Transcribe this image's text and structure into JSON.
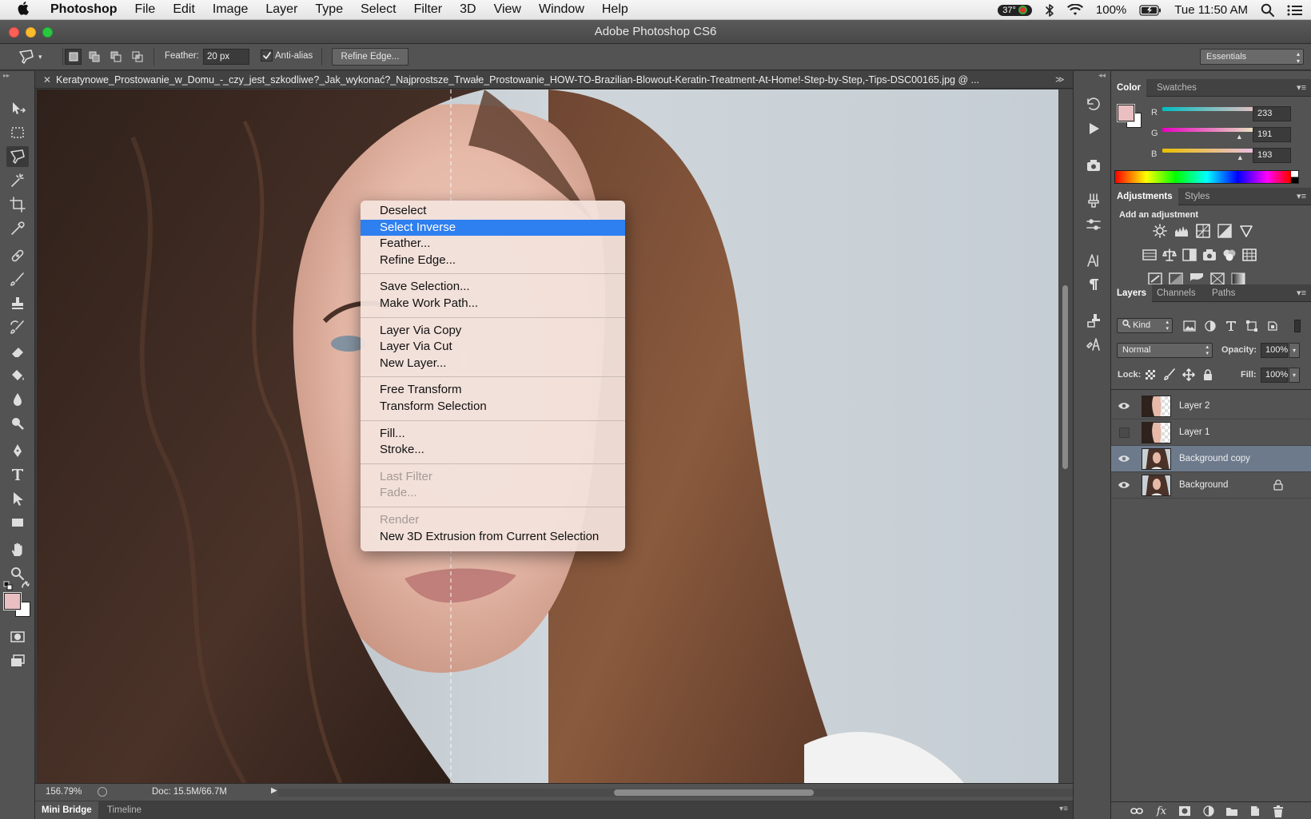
{
  "menubar": {
    "apple": "",
    "app_name": "Photoshop",
    "items": [
      "File",
      "Edit",
      "Image",
      "Layer",
      "Type",
      "Select",
      "Filter",
      "3D",
      "View",
      "Window",
      "Help"
    ],
    "temp": "37°",
    "battery": "100%",
    "clock": "Tue 11:50 AM"
  },
  "window": {
    "title": "Adobe Photoshop CS6"
  },
  "options": {
    "feather_label": "Feather:",
    "feather_value": "20 px",
    "antialias_label": "Anti-alias",
    "refine_edge": "Refine Edge...",
    "workspace": "Essentials"
  },
  "document": {
    "tab_title": "Keratynowe_Prostowanie_w_Domu_-_czy_jest_szkodliwe?_Jak_wykonać?_Najprostsze_Trwałe_Prostowanie_HOW-TO-Brazilian-Blowout-Keratin-Treatment-At-Home!-Step-by-Step,-Tips-DSC00165.jpg @ ...",
    "zoom": "156.79%",
    "doc_size": "Doc: 15.5M/66.7M"
  },
  "bottom_tabs": [
    "Mini Bridge",
    "Timeline"
  ],
  "context_menu": {
    "groups": [
      [
        {
          "label": "Deselect"
        },
        {
          "label": "Select Inverse",
          "selected": true
        },
        {
          "label": "Feather..."
        },
        {
          "label": "Refine Edge..."
        }
      ],
      [
        {
          "label": "Save Selection..."
        },
        {
          "label": "Make Work Path..."
        }
      ],
      [
        {
          "label": "Layer Via Copy"
        },
        {
          "label": "Layer Via Cut"
        },
        {
          "label": "New Layer..."
        }
      ],
      [
        {
          "label": "Free Transform"
        },
        {
          "label": "Transform Selection"
        }
      ],
      [
        {
          "label": "Fill..."
        },
        {
          "label": "Stroke..."
        }
      ],
      [
        {
          "label": "Last Filter",
          "disabled": true
        },
        {
          "label": "Fade...",
          "disabled": true
        }
      ],
      [
        {
          "label": "Render",
          "disabled": true
        },
        {
          "label": "New 3D Extrusion from Current Selection"
        }
      ]
    ]
  },
  "color_panel": {
    "tabs": [
      "Color",
      "Swatches"
    ],
    "channels": [
      {
        "name": "R",
        "value": "233",
        "fraction": 0.914
      },
      {
        "name": "G",
        "value": "191",
        "fraction": 0.749
      },
      {
        "name": "B",
        "value": "193",
        "fraction": 0.757
      }
    ],
    "foreground": "#e9bfc1",
    "background": "#ffffff"
  },
  "adjustments_panel": {
    "tabs": [
      "Adjustments",
      "Styles"
    ],
    "heading": "Add an adjustment"
  },
  "layers_panel": {
    "tabs": [
      "Layers",
      "Channels",
      "Paths"
    ],
    "filter": "Kind",
    "blend_mode": "Normal",
    "opacity_label": "Opacity:",
    "opacity": "100%",
    "lock_label": "Lock:",
    "fill_label": "Fill:",
    "fill": "100%",
    "layers": [
      {
        "name": "Layer 2",
        "visible": true,
        "selected": false,
        "locked": false
      },
      {
        "name": "Layer 1",
        "visible": false,
        "selected": false,
        "locked": false
      },
      {
        "name": "Background copy",
        "visible": true,
        "selected": true,
        "locked": false
      },
      {
        "name": "Background",
        "visible": true,
        "selected": false,
        "locked": true
      }
    ]
  }
}
